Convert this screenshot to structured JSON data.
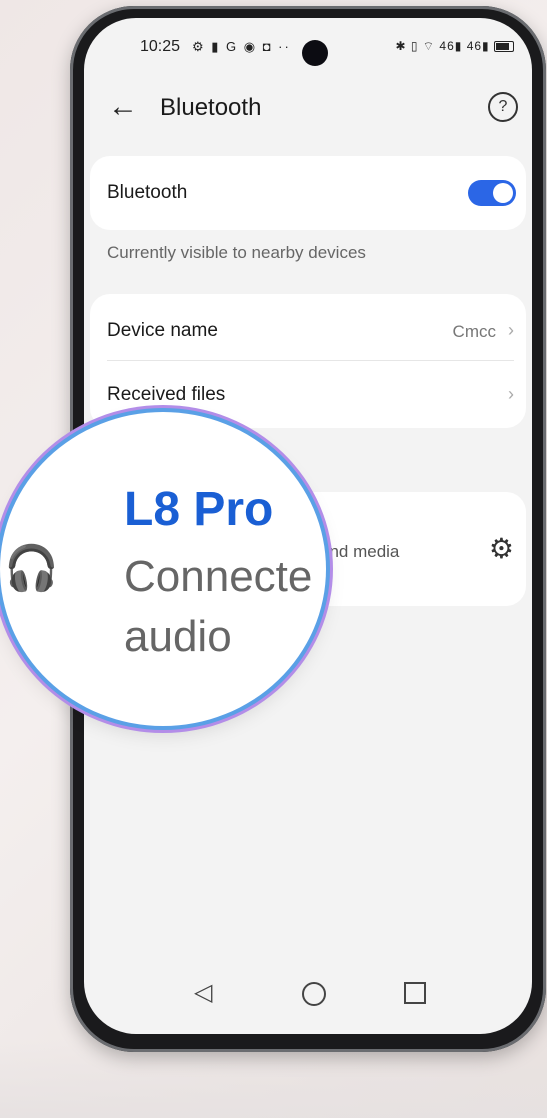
{
  "status_bar": {
    "time": "10:25",
    "left_icons": "⚙ ▮ G ◉ ◘ ··",
    "right_icons": "✱ ▯ ⌔ 46▮ 46▮"
  },
  "header": {
    "title": "Bluetooth",
    "back_icon": "arrow-left",
    "help_icon": "question-circle"
  },
  "bluetooth_toggle": {
    "label": "Bluetooth",
    "enabled": true,
    "accent": "#2b66e6"
  },
  "visibility_text": "Currently visible to nearby devices",
  "device_settings": [
    {
      "label": "Device name",
      "value": "Cmcc"
    },
    {
      "label": "Received files",
      "value": ""
    }
  ],
  "paired_device": {
    "name": "L8 Pro",
    "status_line1": "Connecte",
    "status_line2": "audio",
    "visible_tail": "and media",
    "icon": "headphones"
  },
  "nav": {
    "back": "◁",
    "home": "○",
    "recent": "□"
  }
}
